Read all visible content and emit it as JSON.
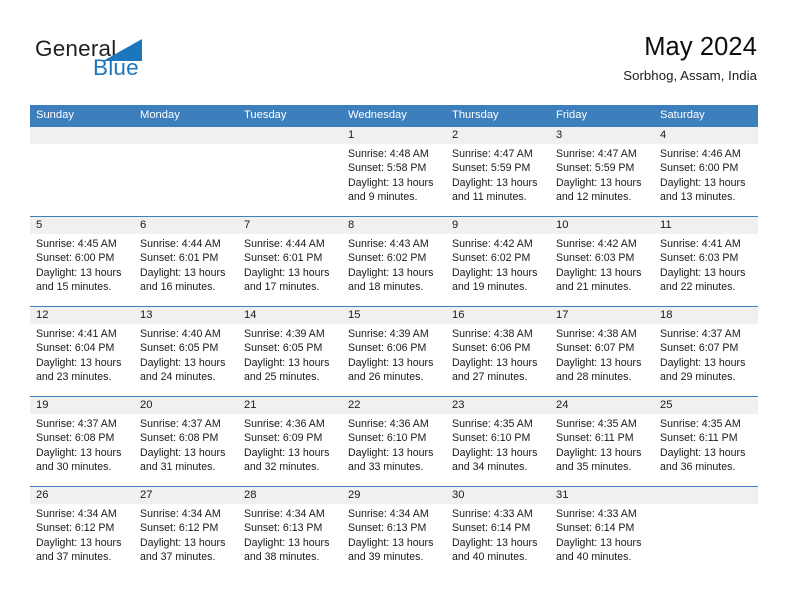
{
  "brand": {
    "word_one": "General",
    "word_two": "Blue",
    "mark": "triangle-flag-icon",
    "colors": {
      "blue": "#1b76bc",
      "dark": "#231f20"
    }
  },
  "header": {
    "title": "May 2024",
    "subtitle": "Sorbhog, Assam, India"
  },
  "colors": {
    "header_blue": "#3d7ebd",
    "num_band": "#f0f0f0",
    "text": "#1a1a1a"
  },
  "calendar": {
    "weekdays": [
      "Sunday",
      "Monday",
      "Tuesday",
      "Wednesday",
      "Thursday",
      "Friday",
      "Saturday"
    ],
    "labels": {
      "sunrise": "Sunrise:",
      "sunset": "Sunset:",
      "daylight": "Daylight:"
    },
    "weeks": [
      [
        {
          "day": "",
          "sunrise": "",
          "sunset": "",
          "daylight_1": "",
          "daylight_2": ""
        },
        {
          "day": "",
          "sunrise": "",
          "sunset": "",
          "daylight_1": "",
          "daylight_2": ""
        },
        {
          "day": "",
          "sunrise": "",
          "sunset": "",
          "daylight_1": "",
          "daylight_2": ""
        },
        {
          "day": "1",
          "sunrise": "Sunrise: 4:48 AM",
          "sunset": "Sunset: 5:58 PM",
          "daylight_1": "Daylight: 13 hours",
          "daylight_2": "and 9 minutes."
        },
        {
          "day": "2",
          "sunrise": "Sunrise: 4:47 AM",
          "sunset": "Sunset: 5:59 PM",
          "daylight_1": "Daylight: 13 hours",
          "daylight_2": "and 11 minutes."
        },
        {
          "day": "3",
          "sunrise": "Sunrise: 4:47 AM",
          "sunset": "Sunset: 5:59 PM",
          "daylight_1": "Daylight: 13 hours",
          "daylight_2": "and 12 minutes."
        },
        {
          "day": "4",
          "sunrise": "Sunrise: 4:46 AM",
          "sunset": "Sunset: 6:00 PM",
          "daylight_1": "Daylight: 13 hours",
          "daylight_2": "and 13 minutes."
        }
      ],
      [
        {
          "day": "5",
          "sunrise": "Sunrise: 4:45 AM",
          "sunset": "Sunset: 6:00 PM",
          "daylight_1": "Daylight: 13 hours",
          "daylight_2": "and 15 minutes."
        },
        {
          "day": "6",
          "sunrise": "Sunrise: 4:44 AM",
          "sunset": "Sunset: 6:01 PM",
          "daylight_1": "Daylight: 13 hours",
          "daylight_2": "and 16 minutes."
        },
        {
          "day": "7",
          "sunrise": "Sunrise: 4:44 AM",
          "sunset": "Sunset: 6:01 PM",
          "daylight_1": "Daylight: 13 hours",
          "daylight_2": "and 17 minutes."
        },
        {
          "day": "8",
          "sunrise": "Sunrise: 4:43 AM",
          "sunset": "Sunset: 6:02 PM",
          "daylight_1": "Daylight: 13 hours",
          "daylight_2": "and 18 minutes."
        },
        {
          "day": "9",
          "sunrise": "Sunrise: 4:42 AM",
          "sunset": "Sunset: 6:02 PM",
          "daylight_1": "Daylight: 13 hours",
          "daylight_2": "and 19 minutes."
        },
        {
          "day": "10",
          "sunrise": "Sunrise: 4:42 AM",
          "sunset": "Sunset: 6:03 PM",
          "daylight_1": "Daylight: 13 hours",
          "daylight_2": "and 21 minutes."
        },
        {
          "day": "11",
          "sunrise": "Sunrise: 4:41 AM",
          "sunset": "Sunset: 6:03 PM",
          "daylight_1": "Daylight: 13 hours",
          "daylight_2": "and 22 minutes."
        }
      ],
      [
        {
          "day": "12",
          "sunrise": "Sunrise: 4:41 AM",
          "sunset": "Sunset: 6:04 PM",
          "daylight_1": "Daylight: 13 hours",
          "daylight_2": "and 23 minutes."
        },
        {
          "day": "13",
          "sunrise": "Sunrise: 4:40 AM",
          "sunset": "Sunset: 6:05 PM",
          "daylight_1": "Daylight: 13 hours",
          "daylight_2": "and 24 minutes."
        },
        {
          "day": "14",
          "sunrise": "Sunrise: 4:39 AM",
          "sunset": "Sunset: 6:05 PM",
          "daylight_1": "Daylight: 13 hours",
          "daylight_2": "and 25 minutes."
        },
        {
          "day": "15",
          "sunrise": "Sunrise: 4:39 AM",
          "sunset": "Sunset: 6:06 PM",
          "daylight_1": "Daylight: 13 hours",
          "daylight_2": "and 26 minutes."
        },
        {
          "day": "16",
          "sunrise": "Sunrise: 4:38 AM",
          "sunset": "Sunset: 6:06 PM",
          "daylight_1": "Daylight: 13 hours",
          "daylight_2": "and 27 minutes."
        },
        {
          "day": "17",
          "sunrise": "Sunrise: 4:38 AM",
          "sunset": "Sunset: 6:07 PM",
          "daylight_1": "Daylight: 13 hours",
          "daylight_2": "and 28 minutes."
        },
        {
          "day": "18",
          "sunrise": "Sunrise: 4:37 AM",
          "sunset": "Sunset: 6:07 PM",
          "daylight_1": "Daylight: 13 hours",
          "daylight_2": "and 29 minutes."
        }
      ],
      [
        {
          "day": "19",
          "sunrise": "Sunrise: 4:37 AM",
          "sunset": "Sunset: 6:08 PM",
          "daylight_1": "Daylight: 13 hours",
          "daylight_2": "and 30 minutes."
        },
        {
          "day": "20",
          "sunrise": "Sunrise: 4:37 AM",
          "sunset": "Sunset: 6:08 PM",
          "daylight_1": "Daylight: 13 hours",
          "daylight_2": "and 31 minutes."
        },
        {
          "day": "21",
          "sunrise": "Sunrise: 4:36 AM",
          "sunset": "Sunset: 6:09 PM",
          "daylight_1": "Daylight: 13 hours",
          "daylight_2": "and 32 minutes."
        },
        {
          "day": "22",
          "sunrise": "Sunrise: 4:36 AM",
          "sunset": "Sunset: 6:10 PM",
          "daylight_1": "Daylight: 13 hours",
          "daylight_2": "and 33 minutes."
        },
        {
          "day": "23",
          "sunrise": "Sunrise: 4:35 AM",
          "sunset": "Sunset: 6:10 PM",
          "daylight_1": "Daylight: 13 hours",
          "daylight_2": "and 34 minutes."
        },
        {
          "day": "24",
          "sunrise": "Sunrise: 4:35 AM",
          "sunset": "Sunset: 6:11 PM",
          "daylight_1": "Daylight: 13 hours",
          "daylight_2": "and 35 minutes."
        },
        {
          "day": "25",
          "sunrise": "Sunrise: 4:35 AM",
          "sunset": "Sunset: 6:11 PM",
          "daylight_1": "Daylight: 13 hours",
          "daylight_2": "and 36 minutes."
        }
      ],
      [
        {
          "day": "26",
          "sunrise": "Sunrise: 4:34 AM",
          "sunset": "Sunset: 6:12 PM",
          "daylight_1": "Daylight: 13 hours",
          "daylight_2": "and 37 minutes."
        },
        {
          "day": "27",
          "sunrise": "Sunrise: 4:34 AM",
          "sunset": "Sunset: 6:12 PM",
          "daylight_1": "Daylight: 13 hours",
          "daylight_2": "and 37 minutes."
        },
        {
          "day": "28",
          "sunrise": "Sunrise: 4:34 AM",
          "sunset": "Sunset: 6:13 PM",
          "daylight_1": "Daylight: 13 hours",
          "daylight_2": "and 38 minutes."
        },
        {
          "day": "29",
          "sunrise": "Sunrise: 4:34 AM",
          "sunset": "Sunset: 6:13 PM",
          "daylight_1": "Daylight: 13 hours",
          "daylight_2": "and 39 minutes."
        },
        {
          "day": "30",
          "sunrise": "Sunrise: 4:33 AM",
          "sunset": "Sunset: 6:14 PM",
          "daylight_1": "Daylight: 13 hours",
          "daylight_2": "and 40 minutes."
        },
        {
          "day": "31",
          "sunrise": "Sunrise: 4:33 AM",
          "sunset": "Sunset: 6:14 PM",
          "daylight_1": "Daylight: 13 hours",
          "daylight_2": "and 40 minutes."
        },
        {
          "day": "",
          "sunrise": "",
          "sunset": "",
          "daylight_1": "",
          "daylight_2": ""
        }
      ]
    ]
  }
}
